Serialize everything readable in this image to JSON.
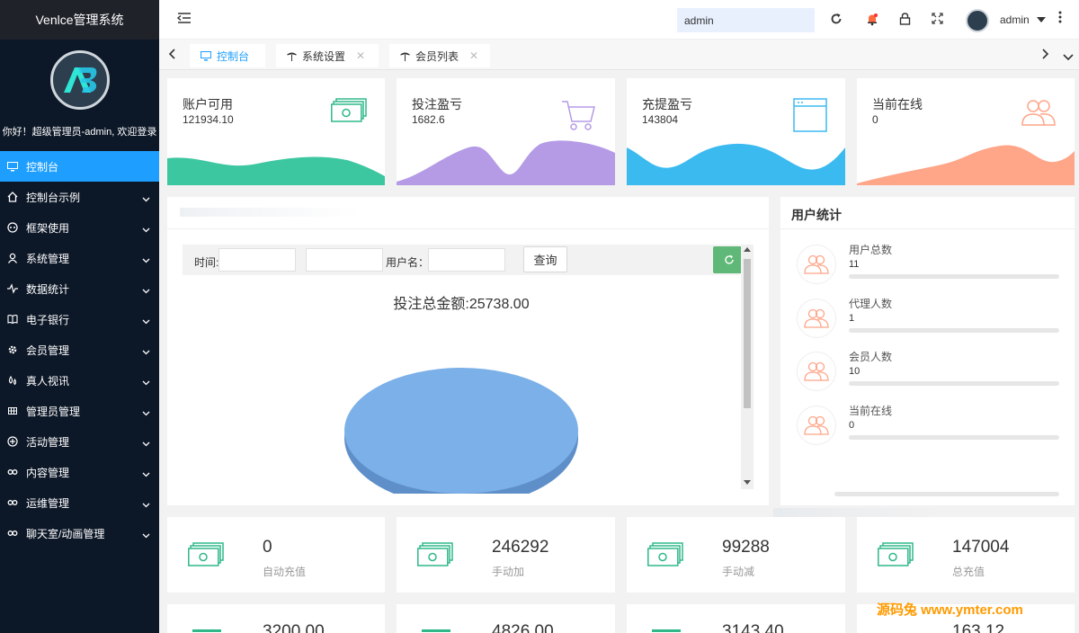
{
  "app": {
    "title": "Venlce管理系统",
    "welcome": "你好！超级管理员-admin, 欢迎登录"
  },
  "sidebar": {
    "items": [
      {
        "label": "控制台",
        "icon": "monitor-icon",
        "active": true
      },
      {
        "label": "控制台示例",
        "icon": "home-icon"
      },
      {
        "label": "框架使用",
        "icon": "gamepad-icon"
      },
      {
        "label": "系统管理",
        "icon": "user-icon"
      },
      {
        "label": "数据统计",
        "icon": "pulse-icon"
      },
      {
        "label": "电子银行",
        "icon": "book-icon"
      },
      {
        "label": "会员管理",
        "icon": "gear-icon"
      },
      {
        "label": "真人视讯",
        "icon": "drops-icon"
      },
      {
        "label": "管理员管理",
        "icon": "table-icon"
      },
      {
        "label": "活动管理",
        "icon": "plus-circle-icon"
      },
      {
        "label": "内容管理",
        "icon": "link-icon"
      },
      {
        "label": "运维管理",
        "icon": "link-icon"
      },
      {
        "label": "聊天室/动画管理",
        "icon": "link-icon"
      }
    ]
  },
  "header": {
    "search_value": "admin",
    "username": "admin"
  },
  "tabs": [
    {
      "label": "控制台",
      "active": true
    },
    {
      "label": "系统设置"
    },
    {
      "label": "会员列表"
    }
  ],
  "stats": [
    {
      "title": "账户可用",
      "value": "121934.10",
      "color": "#3dc7a0",
      "icon": "money-icon"
    },
    {
      "title": "投注盈亏",
      "value": "1682.6",
      "color": "#b59be6",
      "icon": "cart-icon"
    },
    {
      "title": "充提盈亏",
      "value": "143804",
      "color": "#3bbaf0",
      "icon": "browser-icon"
    },
    {
      "title": "当前在线",
      "value": "0",
      "color": "#ffa588",
      "icon": "users-icon"
    }
  ],
  "filter": {
    "time_label": "时间:",
    "username_label": "用户名：",
    "query_button": "查询"
  },
  "chart": {
    "title": "投注总金额:25738.00",
    "color": "#7cb0e8"
  },
  "user_stats": {
    "title": "用户统计",
    "rows": [
      {
        "label": "用户总数",
        "value": "11"
      },
      {
        "label": "代理人数",
        "value": "1"
      },
      {
        "label": "会员人数",
        "value": "10"
      },
      {
        "label": "当前在线",
        "value": "0"
      }
    ]
  },
  "bottom_cards": [
    {
      "value": "0",
      "label": "自动充值"
    },
    {
      "value": "246292",
      "label": "手动加"
    },
    {
      "value": "99288",
      "label": "手动减"
    },
    {
      "value": "147004",
      "label": "总充值"
    }
  ],
  "bottom_cards_row2": [
    "3200.00",
    "4826.00",
    "3143.40",
    "163.12"
  ],
  "watermark": "源码兔 www.ymter.com",
  "colors": {
    "sidebar_bg": "#0c1727",
    "accent": "#1e9fff",
    "money_green": "#2fb88a"
  }
}
